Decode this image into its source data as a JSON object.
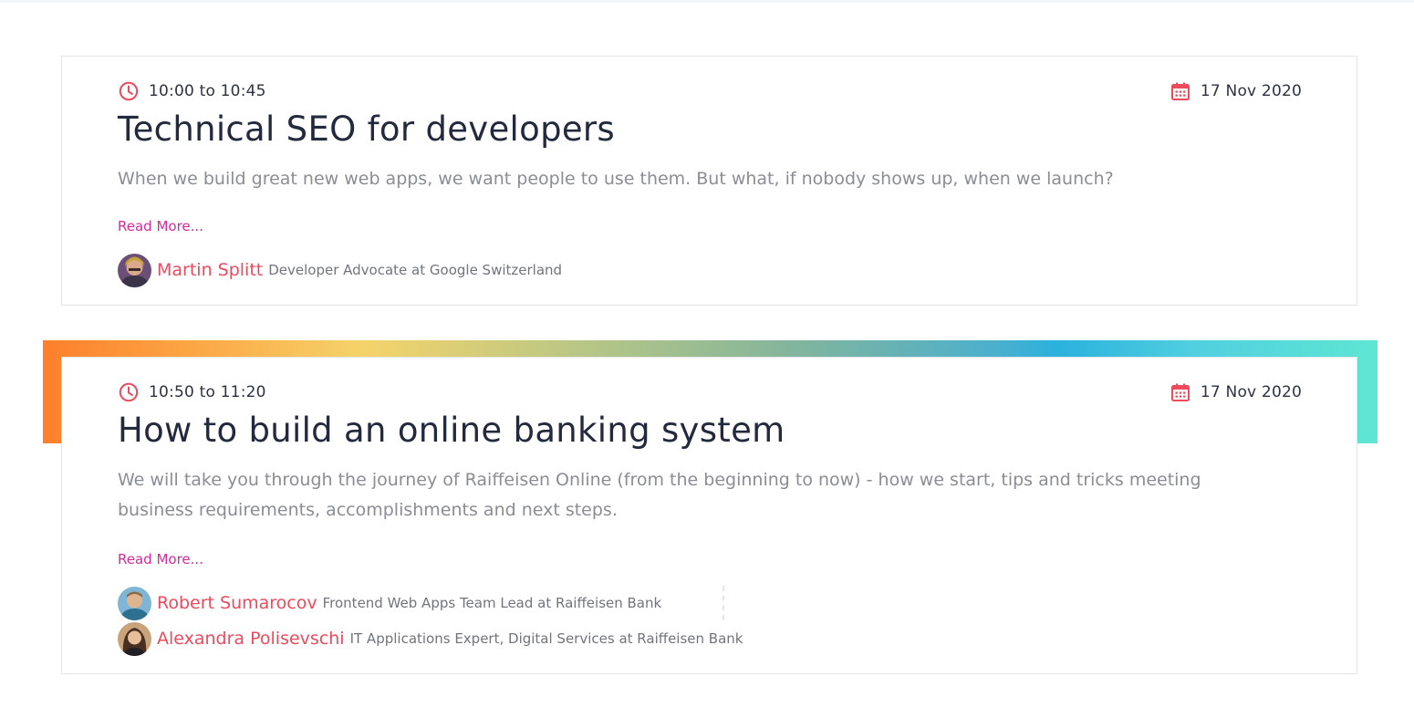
{
  "colors": {
    "accent_red": "#ec4b5d",
    "link_magenta": "#d52a9c",
    "title_navy": "#232a3d",
    "text_gray": "#8a8d93"
  },
  "sessions": [
    {
      "time": "10:00 to 10:45",
      "date": "17 Nov 2020",
      "title": "Technical SEO for developers",
      "description": "When we build great new web apps, we want people to use them. But what, if nobody shows up, when we launch?",
      "read_more": "Read More...",
      "time_icon": "clock-icon",
      "date_icon": "calendar-icon",
      "speakers": [
        {
          "name": "Martin Splitt",
          "role": "Developer Advocate at Google Switzerland"
        }
      ]
    },
    {
      "time": "10:50 to 11:20",
      "date": "17 Nov 2020",
      "title": "How to build an online banking system",
      "description": "We will take you through the journey of Raiffeisen Online (from the beginning to now) - how we start, tips and tricks meeting business requirements, accomplishments and next steps.",
      "read_more": "Read More...",
      "time_icon": "clock-icon",
      "date_icon": "calendar-icon",
      "speakers": [
        {
          "name": "Robert Sumarocov",
          "role": "Frontend Web Apps Team Lead at Raiffeisen Bank"
        },
        {
          "name": "Alexandra Polisevschi",
          "role": "IT Applications Expert, Digital Services at Raiffeisen Bank"
        }
      ]
    }
  ]
}
